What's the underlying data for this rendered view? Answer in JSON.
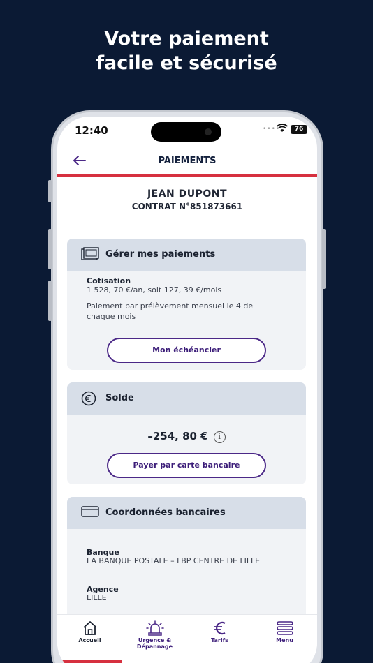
{
  "promo": {
    "line1": "Votre paiement",
    "line2": "facile et sécurisé"
  },
  "status_bar": {
    "time": "12:40",
    "battery": "76"
  },
  "header": {
    "title": "PAIEMENTS"
  },
  "client": {
    "name": "JEAN DUPONT",
    "contract": "CONTRAT N°851873661"
  },
  "payments_card": {
    "title": "Gérer mes paiements",
    "cotisation_label": "Cotisation",
    "cotisation_value": "1 528, 70 €/an, soit 127, 39 €/mois",
    "payment_info": "Paiement par prélèvement mensuel le 4 de chaque mois",
    "schedule_button": "Mon échéancier"
  },
  "balance_card": {
    "title": "Solde",
    "amount": "–254, 80 €",
    "pay_button": "Payer par carte bancaire"
  },
  "bank_card": {
    "title": "Coordonnées bancaires",
    "bank_label": "Banque",
    "bank_value": "LA BANQUE POSTALE – LBP CENTRE DE LILLE",
    "agency_label": "Agence",
    "agency_value": "LILLE"
  },
  "tabs": [
    {
      "label": "Accueil",
      "icon": "home-icon",
      "active": true
    },
    {
      "label": "Urgence & Dépannage",
      "icon": "siren-icon",
      "active": false
    },
    {
      "label": "Tarifs",
      "icon": "euro-icon",
      "active": false
    },
    {
      "label": "Menu",
      "icon": "menu-icon",
      "active": false
    }
  ],
  "colors": {
    "background": "#0b1a34",
    "accent": "#4b2887",
    "brand_red": "#d6303f",
    "card_header": "#d7dee8"
  }
}
